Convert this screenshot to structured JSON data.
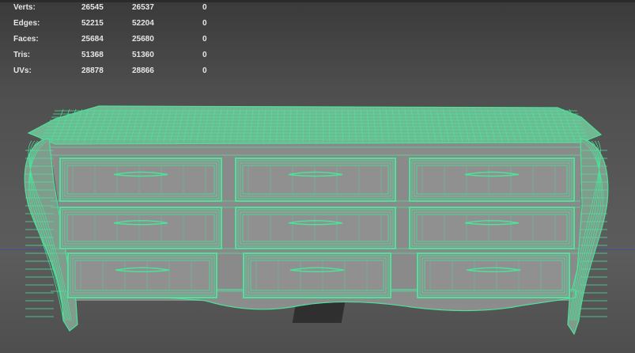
{
  "hud": {
    "rows": [
      {
        "label": "Verts:",
        "v1": "26545",
        "v2": "26537",
        "v3": "0"
      },
      {
        "label": "Edges:",
        "v1": "52215",
        "v2": "52204",
        "v3": "0"
      },
      {
        "label": "Faces:",
        "v1": "25684",
        "v2": "25680",
        "v3": "0"
      },
      {
        "label": "Tris:",
        "v1": "51368",
        "v2": "51360",
        "v3": "0"
      },
      {
        "label": "UVs:",
        "v1": "28878",
        "v2": "28866",
        "v3": "0"
      }
    ]
  },
  "colors": {
    "wireframe": "#4be39a",
    "body_fill": "#8a8a8a",
    "hud_text": "#e6e6e6",
    "horizon_line": "#3b4fa0"
  }
}
